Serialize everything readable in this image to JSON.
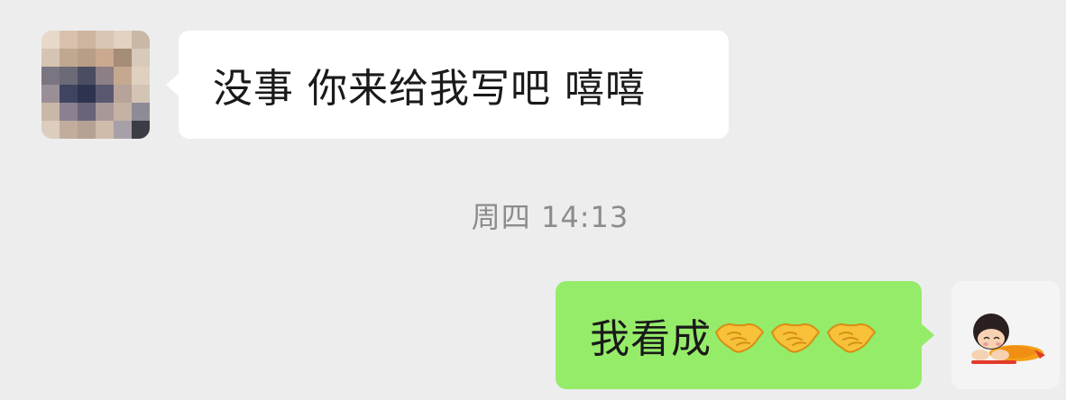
{
  "conversation": {
    "incoming_message": {
      "text": "没事 你来给我写吧 嘻嘻",
      "avatar_icon": "pixelated-avatar-icon"
    },
    "timestamp": "周四 14:13",
    "outgoing_message": {
      "text": "我看成",
      "emoji": [
        "handshake-icon",
        "handshake-icon",
        "handshake-icon"
      ],
      "avatar_icon": "cartoon-girl-avatar-icon"
    }
  },
  "colors": {
    "background": "#ededed",
    "incoming_bubble": "#ffffff",
    "outgoing_bubble": "#95ec69",
    "timestamp_text": "#8c8c8c",
    "message_text": "#1a1a1a"
  }
}
